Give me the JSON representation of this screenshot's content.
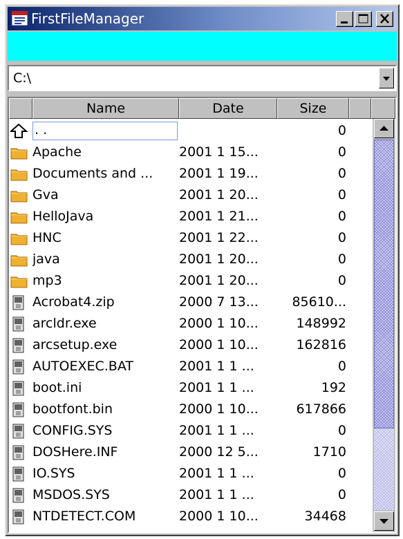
{
  "window": {
    "title": "FirstFileManager"
  },
  "path_combo": {
    "value": "C:\\"
  },
  "columns": {
    "name": "Name",
    "date": "Date",
    "size": "Size"
  },
  "rows": [
    {
      "icon": "up-folder-icon",
      "name": ". .",
      "date": "",
      "size": "0"
    },
    {
      "icon": "folder-icon",
      "name": "Apache",
      "date": "2001 1 15...",
      "size": "0"
    },
    {
      "icon": "folder-icon",
      "name": "Documents and ...",
      "date": "2001 1 19...",
      "size": "0"
    },
    {
      "icon": "folder-icon",
      "name": "Gva",
      "date": "2001 1 20...",
      "size": "0"
    },
    {
      "icon": "folder-icon",
      "name": "HelloJava",
      "date": "2001 1 21...",
      "size": "0"
    },
    {
      "icon": "folder-icon",
      "name": "HNC",
      "date": "2001 1 22...",
      "size": "0"
    },
    {
      "icon": "folder-icon",
      "name": "java",
      "date": "2001 1 20...",
      "size": "0"
    },
    {
      "icon": "folder-icon",
      "name": "mp3",
      "date": "2001 1 20...",
      "size": "0"
    },
    {
      "icon": "file-icon",
      "name": "Acrobat4.zip",
      "date": "2000 7 13...",
      "size": "85610..."
    },
    {
      "icon": "file-icon",
      "name": "arcldr.exe",
      "date": "2000 1 10...",
      "size": "148992"
    },
    {
      "icon": "file-icon",
      "name": "arcsetup.exe",
      "date": "2000 1 10...",
      "size": "162816"
    },
    {
      "icon": "file-icon",
      "name": "AUTOEXEC.BAT",
      "date": "2001 1 1   ...",
      "size": "0"
    },
    {
      "icon": "file-icon",
      "name": "boot.ini",
      "date": "2001 1 1   ...",
      "size": "192"
    },
    {
      "icon": "file-icon",
      "name": "bootfont.bin",
      "date": "2000 1 10...",
      "size": "617866"
    },
    {
      "icon": "file-icon",
      "name": "CONFIG.SYS",
      "date": "2001 1 1   ...",
      "size": "0"
    },
    {
      "icon": "file-icon",
      "name": "DOSHere.INF",
      "date": "2000 12 5...",
      "size": "1710"
    },
    {
      "icon": "file-icon",
      "name": "IO.SYS",
      "date": "2001 1 1   ...",
      "size": "0"
    },
    {
      "icon": "file-icon",
      "name": "MSDOS.SYS",
      "date": "2001 1 1   ...",
      "size": "0"
    },
    {
      "icon": "file-icon",
      "name": "NTDETECT.COM",
      "date": "2000 1 10...",
      "size": "34468"
    }
  ],
  "colors": {
    "title_start": "#0a246a",
    "toolbar_bg": "#00ffff",
    "folder": "#f0b030",
    "chrome": "#c0c0c0"
  }
}
